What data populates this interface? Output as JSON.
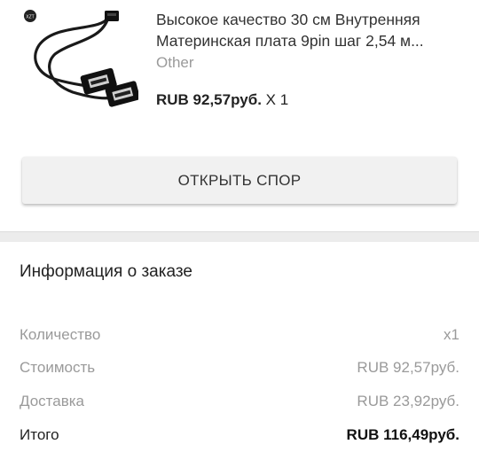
{
  "product": {
    "image_icon": "usb-cable-image",
    "title": "Высокое качество 30 см Внутренняя Материнская плата 9pin шаг 2,54 м...",
    "variant": "Other",
    "price": "RUB 92,57руб.",
    "quantity": "X 1"
  },
  "actions": {
    "open_dispute": "ОТКРЫТЬ СПОР"
  },
  "order_info": {
    "title": "Информация о заказе",
    "rows": [
      {
        "label": "Количество",
        "value": "x1"
      },
      {
        "label": "Стоимость",
        "value": "RUB 92,57руб."
      },
      {
        "label": "Доставка",
        "value": "RUB 23,92руб."
      },
      {
        "label": "Итого",
        "value": "RUB 116,49руб."
      }
    ]
  }
}
